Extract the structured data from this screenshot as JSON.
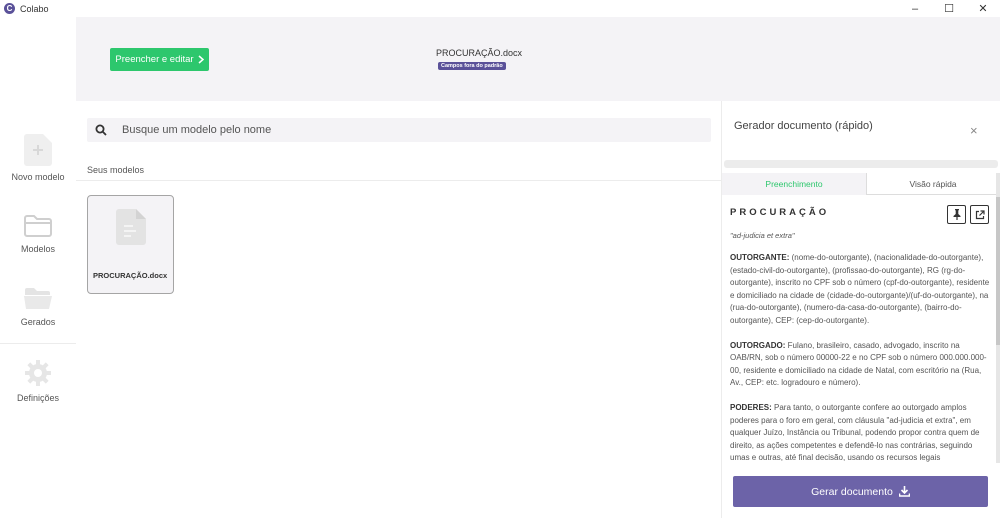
{
  "app": {
    "title": "Colabo",
    "logo_letter": "C"
  },
  "window_controls": {
    "minimize": "–",
    "maximize": "☐",
    "close": "✕"
  },
  "sidebar": {
    "items": [
      {
        "label": "Novo modelo",
        "icon": "new-document-icon"
      },
      {
        "label": "Modelos",
        "icon": "folder-icon"
      },
      {
        "label": "Gerados",
        "icon": "folder-open-icon"
      },
      {
        "label": "Definições",
        "icon": "gear-icon"
      }
    ]
  },
  "banner": {
    "fill_edit_label": "Preencher e editar",
    "document_name": "PROCURAÇÃO.docx",
    "badge": "Campos fora do padrão"
  },
  "search": {
    "placeholder": "Busque um modelo pelo nome"
  },
  "models": {
    "section_label": "Seus modelos",
    "items": [
      {
        "name": "PROCURAÇÃO.docx"
      }
    ]
  },
  "panel": {
    "title": "Gerador documento (rápido)",
    "close": "×",
    "tabs": [
      {
        "label": "Preenchimento",
        "active": true
      },
      {
        "label": "Visão rápida",
        "active": false
      }
    ],
    "document": {
      "title": "PROCURAÇÃO",
      "subtitle": "\"ad-judicia et extra\"",
      "paragraphs": [
        {
          "heading": "OUTORGANTE:",
          "text": " (nome-do-outorgante), (nacionalidade-do-outorgante), (estado-civil-do-outorgante), (profissao-do-outorgante), RG (rg-do-outorgante), inscrito no CPF sob o número (cpf-do-outorgante), residente e domiciliado na cidade de (cidade-do-outorgante)/(uf-do-outorgante), na (rua-do-outorgante), (numero-da-casa-do-outorgante), (bairro-do-outorgante), CEP: (cep-do-outorgante)."
        },
        {
          "heading": "OUTORGADO:",
          "text": " Fulano, brasileiro, casado, advogado, inscrito na OAB/RN, sob o número 00000-22 e no CPF sob o número 000.000.000-00, residente e domiciliado na cidade de Natal, com escritório na (Rua, Av., CEP: etc. logradouro e número)."
        },
        {
          "heading": "PODERES:",
          "text": " Para tanto, o outorgante confere ao outorgado amplos poderes para o foro em geral, com cláusula \"ad-judicia et extra\", em qualquer Juízo, Instância ou Tribunal, podendo propor contra quem de direito, as ações competentes e defendê-lo nas contrárias, seguindo umas e outras, até final decisão, usando os recursos legais"
        }
      ]
    },
    "generate_label": "Gerar documento"
  },
  "colors": {
    "accent_green": "#2dc76d",
    "accent_purple": "#5a5199",
    "button_purple": "#6c63a8"
  }
}
